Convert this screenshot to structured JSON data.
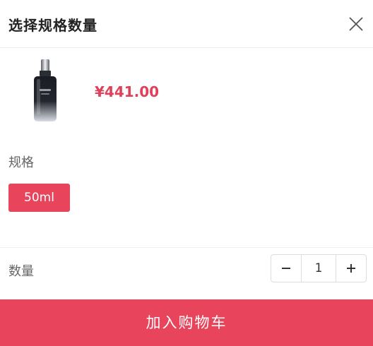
{
  "header": {
    "title": "选择规格数量",
    "close_icon": "close-icon"
  },
  "product": {
    "image_icon": "serum-bottle-image",
    "price": "¥441.00"
  },
  "spec": {
    "label": "规格",
    "selected_option": "50ml",
    "options": [
      "50ml"
    ]
  },
  "quantity": {
    "label": "数量",
    "value": "1",
    "minus_icon": "minus-icon",
    "plus_icon": "plus-icon"
  },
  "cart": {
    "button_label": "加入购物车"
  },
  "colors": {
    "accent": "#e8455c",
    "price": "#e0405a",
    "label": "#666666"
  }
}
